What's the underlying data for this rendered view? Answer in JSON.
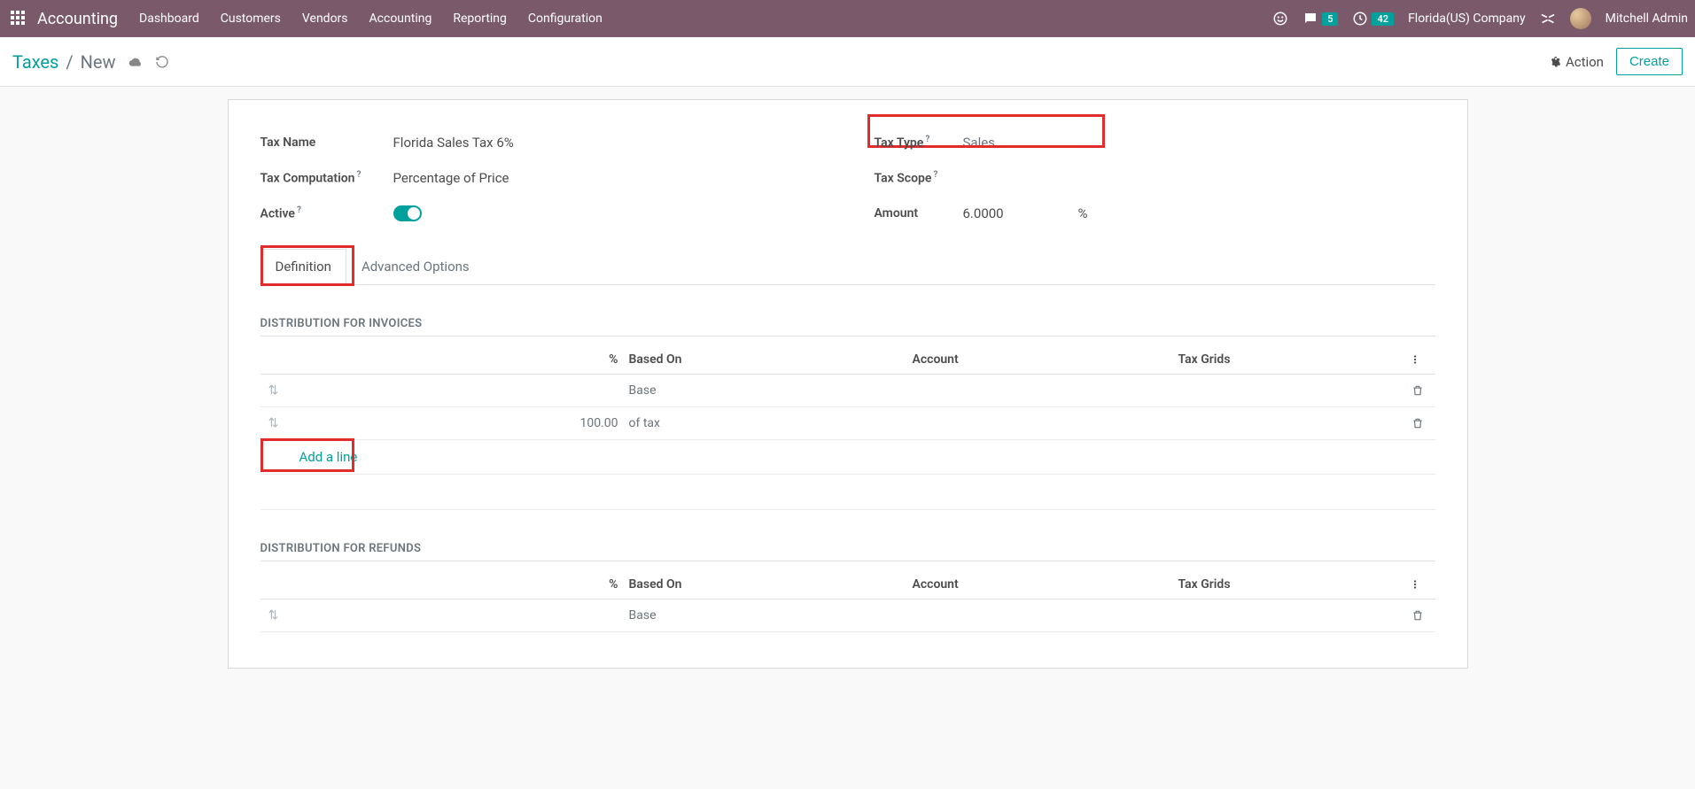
{
  "navbar": {
    "brand": "Accounting",
    "menu": [
      "Dashboard",
      "Customers",
      "Vendors",
      "Accounting",
      "Reporting",
      "Configuration"
    ],
    "messages_count": "5",
    "activities_count": "42",
    "company": "Florida(US) Company",
    "user": "Mitchell Admin"
  },
  "control_panel": {
    "breadcrumb_root": "Taxes",
    "breadcrumb_current": "New",
    "action_label": "Action",
    "create_label": "Create"
  },
  "form": {
    "tax_name_label": "Tax Name",
    "tax_name_value": "Florida Sales Tax 6%",
    "tax_computation_label": "Tax Computation",
    "tax_computation_value": "Percentage of Price",
    "active_label": "Active",
    "tax_type_label": "Tax Type",
    "tax_type_value": "Sales",
    "tax_scope_label": "Tax Scope",
    "tax_scope_value": "",
    "amount_label": "Amount",
    "amount_value": "6.0000",
    "amount_unit": "%"
  },
  "tabs": {
    "definition": "Definition",
    "advanced": "Advanced Options"
  },
  "sections": {
    "invoices_header": "DISTRIBUTION FOR INVOICES",
    "refunds_header": "DISTRIBUTION FOR REFUNDS",
    "col_pct": "%",
    "col_based": "Based On",
    "col_account": "Account",
    "col_grids": "Tax Grids",
    "add_line": "Add a line",
    "invoices_rows": [
      {
        "pct": "",
        "based": "Base"
      },
      {
        "pct": "100.00",
        "based": "of tax"
      }
    ],
    "refunds_rows": [
      {
        "pct": "",
        "based": "Base"
      }
    ]
  }
}
